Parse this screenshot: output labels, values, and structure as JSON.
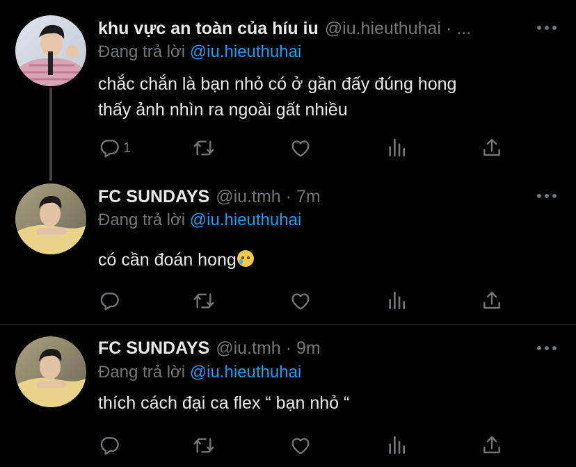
{
  "tweets": [
    {
      "name": "khu vực an toàn của híu iu",
      "handle": "@iu.hieuthuhai",
      "separator": "·",
      "time": "...",
      "replying_prefix": "Đang trả lời",
      "replying_to": "@iu.hieuthuhai",
      "text_lines": [
        "chắc chắn là bạn nhỏ có ở gần đấy đúng hong",
        "thấy ảnh nhìn ra ngoài gất nhiều"
      ],
      "reply_count": "1"
    },
    {
      "name": "FC SUNDAYS",
      "handle": "@iu.tmh",
      "separator": "·",
      "time": "7m",
      "replying_prefix": "Đang trả lời",
      "replying_to": "@iu.hieuthuhai",
      "text_lines": [
        "có cần đoán hong"
      ],
      "text_emoji": "crying-face-emoji",
      "reply_count": ""
    },
    {
      "name": "FC SUNDAYS",
      "handle": "@iu.tmh",
      "separator": "·",
      "time": "9m",
      "replying_prefix": "Đang trả lời",
      "replying_to": "@iu.hieuthuhai",
      "text_lines": [
        "thích cách đại ca flex “ bạn nhỏ “"
      ],
      "reply_count": ""
    }
  ],
  "icons": [
    "reply-icon",
    "retweet-icon",
    "like-icon",
    "analytics-icon",
    "share-icon",
    "more-options-icon"
  ],
  "colors": {
    "background": "#000000",
    "text": "#e7e9ea",
    "secondary": "#71767b",
    "mention": "#1d9bf0",
    "divider": "#2f3336",
    "thread_line": "#3e4144"
  }
}
